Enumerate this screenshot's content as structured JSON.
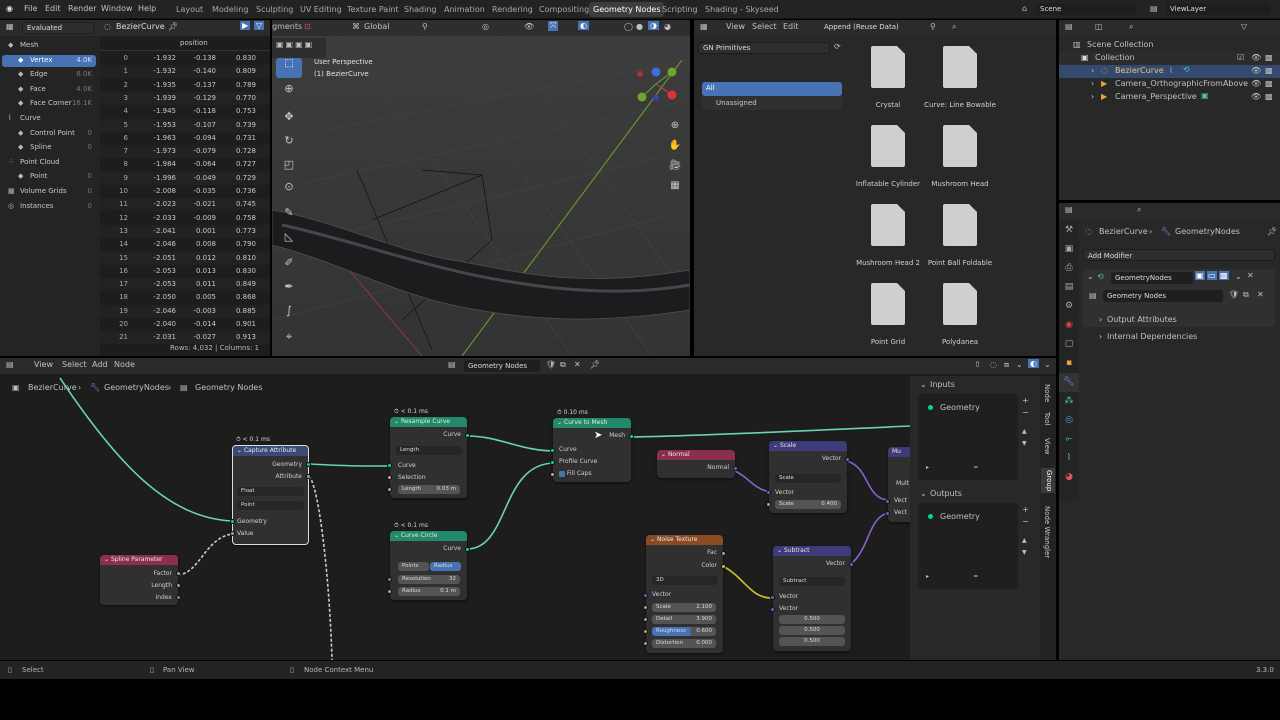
{
  "topbar": {
    "menus": [
      "File",
      "Edit",
      "Render",
      "Window",
      "Help"
    ],
    "workspaces": [
      "Layout",
      "Modeling",
      "Sculpting",
      "UV Editing",
      "Texture Paint",
      "Shading",
      "Animation",
      "Rendering",
      "Compositing",
      "Geometry Nodes",
      "Scripting",
      "Shading - Skyseed"
    ],
    "active": "Geometry Nodes",
    "scene": "Scene",
    "viewlayer": "ViewLayer"
  },
  "spreadsheet": {
    "mode": "Evaluated",
    "object": "BezierCurve",
    "col_header": "position",
    "tree": [
      {
        "label": "Mesh",
        "count": ""
      },
      {
        "label": "Vertex",
        "count": "4.0K"
      },
      {
        "label": "Edge",
        "count": "8.0K"
      },
      {
        "label": "Face",
        "count": "4.0K"
      },
      {
        "label": "Face Corner",
        "count": "16.1K"
      },
      {
        "label": "Curve",
        "count": ""
      },
      {
        "label": "Control Point",
        "count": "0"
      },
      {
        "label": "Spline",
        "count": "0"
      },
      {
        "label": "Point Cloud",
        "count": ""
      },
      {
        "label": "Point",
        "count": "0"
      },
      {
        "label": "Volume Grids",
        "count": "0"
      },
      {
        "label": "Instances",
        "count": "0"
      }
    ],
    "rows": [
      [
        "0",
        "-1.932",
        "-0.138",
        "0.830"
      ],
      [
        "1",
        "-1.932",
        "-0.140",
        "0.809"
      ],
      [
        "2",
        "-1.935",
        "-0.137",
        "0.789"
      ],
      [
        "3",
        "-1.939",
        "-0.129",
        "0.770"
      ],
      [
        "4",
        "-1.945",
        "-0.118",
        "0.753"
      ],
      [
        "5",
        "-1.953",
        "-0.107",
        "0.739"
      ],
      [
        "6",
        "-1.963",
        "-0.094",
        "0.731"
      ],
      [
        "7",
        "-1.973",
        "-0.079",
        "0.728"
      ],
      [
        "8",
        "-1.984",
        "-0.064",
        "0.727"
      ],
      [
        "9",
        "-1.996",
        "-0.049",
        "0.729"
      ],
      [
        "10",
        "-2.008",
        "-0.035",
        "0.736"
      ],
      [
        "11",
        "-2.023",
        "-0.021",
        "0.745"
      ],
      [
        "12",
        "-2.033",
        "-0.009",
        "0.758"
      ],
      [
        "13",
        "-2.041",
        "0.001",
        "0.773"
      ],
      [
        "14",
        "-2.046",
        "0.008",
        "0.790"
      ],
      [
        "15",
        "-2.051",
        "0.012",
        "0.810"
      ],
      [
        "16",
        "-2.053",
        "0.013",
        "0.830"
      ],
      [
        "17",
        "-2.053",
        "0.011",
        "0.849"
      ],
      [
        "18",
        "-2.050",
        "0.005",
        "0.868"
      ],
      [
        "19",
        "-2.046",
        "-0.003",
        "0.885"
      ],
      [
        "20",
        "-2.040",
        "-0.014",
        "0.901"
      ],
      [
        "21",
        "-2.031",
        "-0.027",
        "0.913"
      ]
    ],
    "footer": "Rows: 4,032  |  Columns: 1"
  },
  "viewport": {
    "segments_label": "gments",
    "orientation": "Global",
    "title": "User Perspective",
    "subtitle": "(1) BezierCurve"
  },
  "assets": {
    "menus": [
      "View",
      "Select",
      "Edit"
    ],
    "import_mode": "Append (Reuse Data)",
    "library": "GN Primitives",
    "cat_all": "All",
    "cat_unassigned": "Unassigned",
    "items": [
      "Crystal",
      "Curve: Line Bowable",
      "Inflatable Cylinder",
      "Mushroom Head",
      "Mushroom Head 2",
      "Point Ball Foldable",
      "Point Grid",
      "Polydanea"
    ]
  },
  "outliner": {
    "items": [
      "Scene Collection",
      "Collection",
      "BezierCurve",
      "Camera_OrthographicFromAbove",
      "Camera_Perspective"
    ]
  },
  "properties": {
    "breadcrumb1": "BezierCurve",
    "breadcrumb2": "GeometryNodes",
    "add_modifier": "Add Modifier",
    "modifier_name": "GeometryNodes",
    "nodegroup": "Geometry Nodes",
    "sub1": "Output Attributes",
    "sub2": "Internal Dependencies"
  },
  "nodeeditor": {
    "menus": [
      "View",
      "Select",
      "Add",
      "Node"
    ],
    "tree_name": "Geometry Nodes",
    "bc1": "BezierCurve",
    "bc2": "GeometryNodes",
    "bc3": "Geometry Nodes",
    "side_inputs": "Inputs",
    "side_outputs": "Outputs",
    "side_geo_in": "Geometry",
    "side_geo_out": "Geometry",
    "side_tabs": [
      "Node",
      "Tool",
      "View",
      "Group",
      "Node Wrangler"
    ]
  },
  "nodes": {
    "capture": {
      "time": "< 0.1 ms",
      "title": "Capture Attribute",
      "out_geo": "Geometry",
      "out_attr": "Attribute",
      "type": "Float",
      "domain": "Point",
      "in_geo": "Geometry",
      "in_val": "Value"
    },
    "spline": {
      "title": "Spline Parameter",
      "factor": "Factor",
      "length": "Length",
      "index": "Index"
    },
    "resample": {
      "time": "< 0.1 ms",
      "title": "Resample Curve",
      "out": "Curve",
      "mode": "Length",
      "in_curve": "Curve",
      "sel": "Selection",
      "len_label": "Length",
      "len_val": "0.03 m"
    },
    "circle": {
      "time": "< 0.1 ms",
      "title": "Curve Circle",
      "out": "Curve",
      "mode_a": "Points",
      "mode_b": "Radius",
      "res_label": "Resolution",
      "res_val": "32",
      "rad_label": "Radius",
      "rad_val": "0.1 m"
    },
    "tomesh": {
      "time": "0.10 ms",
      "title": "Curve to Mesh",
      "out": "Mesh",
      "curve": "Curve",
      "profile": "Profile Curve",
      "fill": "Fill Caps"
    },
    "normal": {
      "title": "Normal",
      "out": "Normal"
    },
    "scale": {
      "title": "Scale",
      "out": "Vector",
      "op": "Scale",
      "vec": "Vector",
      "sc_label": "Scale",
      "sc_val": "0.400"
    },
    "noise": {
      "title": "Noise Texture",
      "fac": "Fac",
      "color": "Color",
      "dim": "3D",
      "vec": "Vector",
      "scale_l": "Scale",
      "scale_v": "2.100",
      "detail_l": "Detail",
      "detail_v": "3.900",
      "rough_l": "Roughness",
      "rough_v": "0.600",
      "dist_l": "Distortion",
      "dist_v": "0.000"
    },
    "subtract": {
      "title": "Subtract",
      "out": "Vector",
      "op": "Subtract",
      "vec1": "Vector",
      "vec2": "Vector",
      "v1": "0.500",
      "v2": "0.500",
      "v3": "0.500"
    },
    "mult": {
      "title": "Mu",
      "mul": "Mult",
      "v1": "Vect",
      "v2": "Vect"
    }
  },
  "status": {
    "select": "Select",
    "pan": "Pan View",
    "ctx": "Node Context Menu",
    "version": "3.3.0"
  }
}
